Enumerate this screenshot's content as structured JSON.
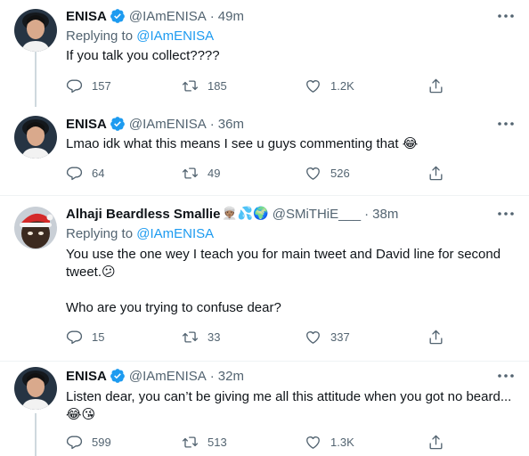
{
  "tweets": [
    {
      "name": "ENISA",
      "verified": true,
      "handle": "@IAmENISA",
      "time": "49m",
      "replying_label": "Replying to",
      "replying_to": "@IAmENISA",
      "lines": [
        "If you talk you collect????"
      ],
      "replies": "157",
      "retweets": "185",
      "likes": "1.2K"
    },
    {
      "name": "ENISA",
      "verified": true,
      "handle": "@IAmENISA",
      "time": "36m",
      "lines": [
        "Lmao idk what this means I see u guys commenting that 😂"
      ],
      "replies": "64",
      "retweets": "49",
      "likes": "526"
    },
    {
      "name": "Alhaji Beardless Smallie",
      "name_emoji": "👳🏽‍♀️💦🌍",
      "handle": "@SMiTHiE___",
      "time": "38m",
      "replying_label": "Replying to",
      "replying_to": "@IAmENISA",
      "lines": [
        "You use the one wey I teach you for main tweet and David line for second",
        "tweet.😕",
        "",
        "Who are you trying to confuse dear?"
      ],
      "replies": "15",
      "retweets": "33",
      "likes": "337"
    },
    {
      "name": "ENISA",
      "verified": true,
      "handle": "@IAmENISA",
      "time": "32m",
      "lines": [
        "Listen dear, you can’t be giving me all this attitude when you got no beard...",
        "😂😘"
      ],
      "replies": "599",
      "retweets": "513",
      "likes": "1.3K"
    }
  ],
  "separator": "·",
  "icons": {
    "verified": "verified-badge-icon",
    "more": "more-dots-icon",
    "reply": "reply-bubble-icon",
    "retweet": "retweet-icon",
    "like": "heart-icon",
    "share": "share-icon"
  },
  "colors": {
    "accent": "#1d9bf0",
    "muted": "#536471",
    "text": "#0f1419",
    "thread_line": "#cfd9de"
  }
}
